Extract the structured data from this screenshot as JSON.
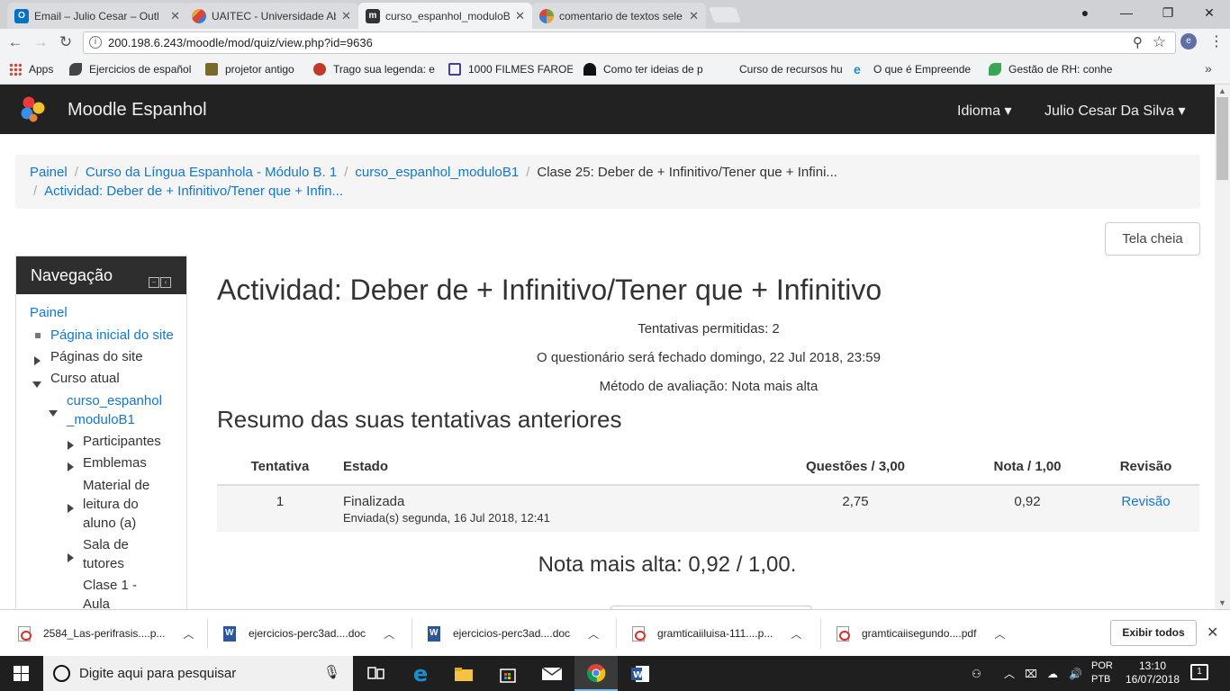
{
  "browser": {
    "tabs": [
      {
        "title": "Email – Julio Cesar – Outl",
        "icon": "outlook-icon",
        "color": "#0072c6",
        "glyph": "O"
      },
      {
        "title": "UAITEC - Universidade Ab",
        "icon": "uaitec-icon",
        "color": "#e8a33a",
        "glyph": ""
      },
      {
        "title": "curso_espanhol_moduloB",
        "icon": "moodle-icon",
        "color": "#333333",
        "glyph": "m"
      },
      {
        "title": "comentario de textos sele",
        "icon": "pinwheel-icon",
        "color": "#7a9f3a",
        "glyph": ""
      }
    ],
    "url": "200.198.6.243/moodle/mod/quiz/view.php?id=9636",
    "bookmarks": [
      "Apps",
      "Ejercicios de español",
      "projetor antigo",
      "Trago sua legenda: e",
      "1000 FILMES FAROES",
      "Como ter ideias de p",
      "Curso de recursos hu",
      "O que é Empreende",
      "Gestão de RH: conhe"
    ]
  },
  "moodle": {
    "brand": "Moodle Espanhol",
    "lang_menu": "Idioma",
    "user_menu": "Julio Cesar Da Silva",
    "breadcrumb": {
      "items": [
        "Painel",
        "Curso da Língua Espanhola - Módulo B. 1",
        "curso_espanhol_moduloB1",
        "Clase 25: Deber de + Infinitivo/Tener que + Infini..."
      ],
      "last": "Actividad: Deber de + Infinitivo/Tener que + Infin..."
    },
    "fullscreen_label": "Tela cheia",
    "nav": {
      "title": "Navegação",
      "items": [
        "Painel",
        "Página inicial do site",
        "Páginas do site",
        "Curso atual",
        "curso_espanhol",
        "_moduloB1",
        "Participantes",
        "Emblemas",
        "Material de",
        "leitura do",
        "aluno (a)",
        "Sala de",
        "tutores",
        "Clase 1 -",
        "Aula"
      ]
    },
    "quiz": {
      "title": "Actividad: Deber de + Infinitivo/Tener que + Infinitivo",
      "attempts_allowed": "Tentativas permitidas: 2",
      "close_date": "O questionário será fechado domingo, 22 Jul 2018, 23:59",
      "grading_method": "Método de avaliação: Nota mais alta",
      "summary_heading": "Resumo das suas tentativas anteriores",
      "table": {
        "headers": [
          "Tentativa",
          "Estado",
          "Questões / 3,00",
          "Nota / 1,00",
          "Revisão"
        ],
        "rows": [
          {
            "attempt": "1",
            "state": "Finalizada",
            "submitted": "Enviada(s) segunda, 16 Jul 2018, 12:41",
            "questions": "2,75",
            "grade": "0,92",
            "review": "Revisão"
          }
        ]
      },
      "highest_grade": "Nota mais alta: 0,92 / 1,00."
    }
  },
  "downloads": {
    "files": [
      {
        "name": "2584_Las-perifrasis....p...",
        "type": "pdf"
      },
      {
        "name": "ejercicios-perc3ad....doc",
        "type": "doc"
      },
      {
        "name": "ejercicios-perc3ad....doc",
        "type": "doc"
      },
      {
        "name": "gramticaiiluisa-111....p...",
        "type": "pdf"
      },
      {
        "name": "gramticaiisegundo....pdf",
        "type": "pdf"
      }
    ],
    "show_all": "Exibir todos"
  },
  "taskbar": {
    "search_placeholder": "Digite aqui para pesquisar",
    "lang1": "POR",
    "lang2": "PTB",
    "time": "13:10",
    "date": "16/07/2018",
    "notifications": "1"
  }
}
